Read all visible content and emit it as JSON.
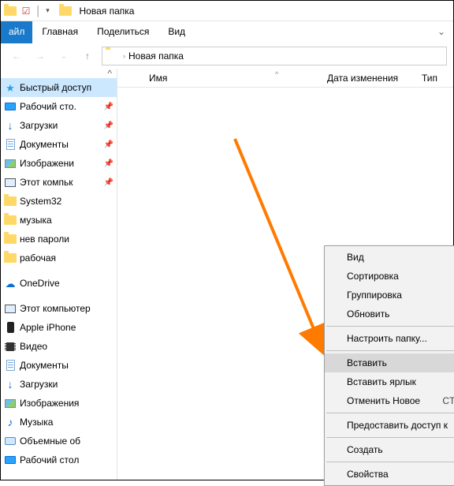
{
  "window": {
    "title": "Новая папка"
  },
  "ribbon": {
    "file": "айл",
    "tabs": [
      "Главная",
      "Поделиться",
      "Вид"
    ]
  },
  "breadcrumb": {
    "current": "Новая папка"
  },
  "columns": {
    "name": "Имя",
    "date": "Дата изменения",
    "type": "Тип"
  },
  "sidebar": {
    "quick": "Быстрый доступ",
    "pinned": [
      {
        "label": "Рабочий сто.",
        "icon": "monitor"
      },
      {
        "label": "Загрузки",
        "icon": "down"
      },
      {
        "label": "Документы",
        "icon": "doc"
      },
      {
        "label": "Изображени",
        "icon": "pic"
      },
      {
        "label": "Этот компьк",
        "icon": "pc"
      },
      {
        "label": "System32",
        "icon": "folder"
      },
      {
        "label": "музыка",
        "icon": "folder"
      },
      {
        "label": "нев пароли",
        "icon": "folder"
      },
      {
        "label": "рабочая",
        "icon": "folder"
      }
    ],
    "onedrive": "OneDrive",
    "thispc": "Этот компьютер",
    "thispc_items": [
      {
        "label": "Apple iPhone",
        "icon": "phone"
      },
      {
        "label": "Видео",
        "icon": "video"
      },
      {
        "label": "Документы",
        "icon": "doc"
      },
      {
        "label": "Загрузки",
        "icon": "down"
      },
      {
        "label": "Изображения",
        "icon": "pic"
      },
      {
        "label": "Музыка",
        "icon": "music"
      },
      {
        "label": "Объемные об",
        "icon": "disk"
      },
      {
        "label": "Рабочий стол",
        "icon": "monitor"
      }
    ]
  },
  "context_menu": {
    "view": "Вид",
    "sort": "Сортировка",
    "group": "Группировка",
    "refresh": "Обновить",
    "customize": "Настроить папку...",
    "paste": "Вставить",
    "paste_shortcut": "Вставить ярлык",
    "undo": "Отменить Новое",
    "undo_sc": "CTR",
    "share": "Предоставить доступ к",
    "new": "Создать",
    "props": "Свойства"
  }
}
